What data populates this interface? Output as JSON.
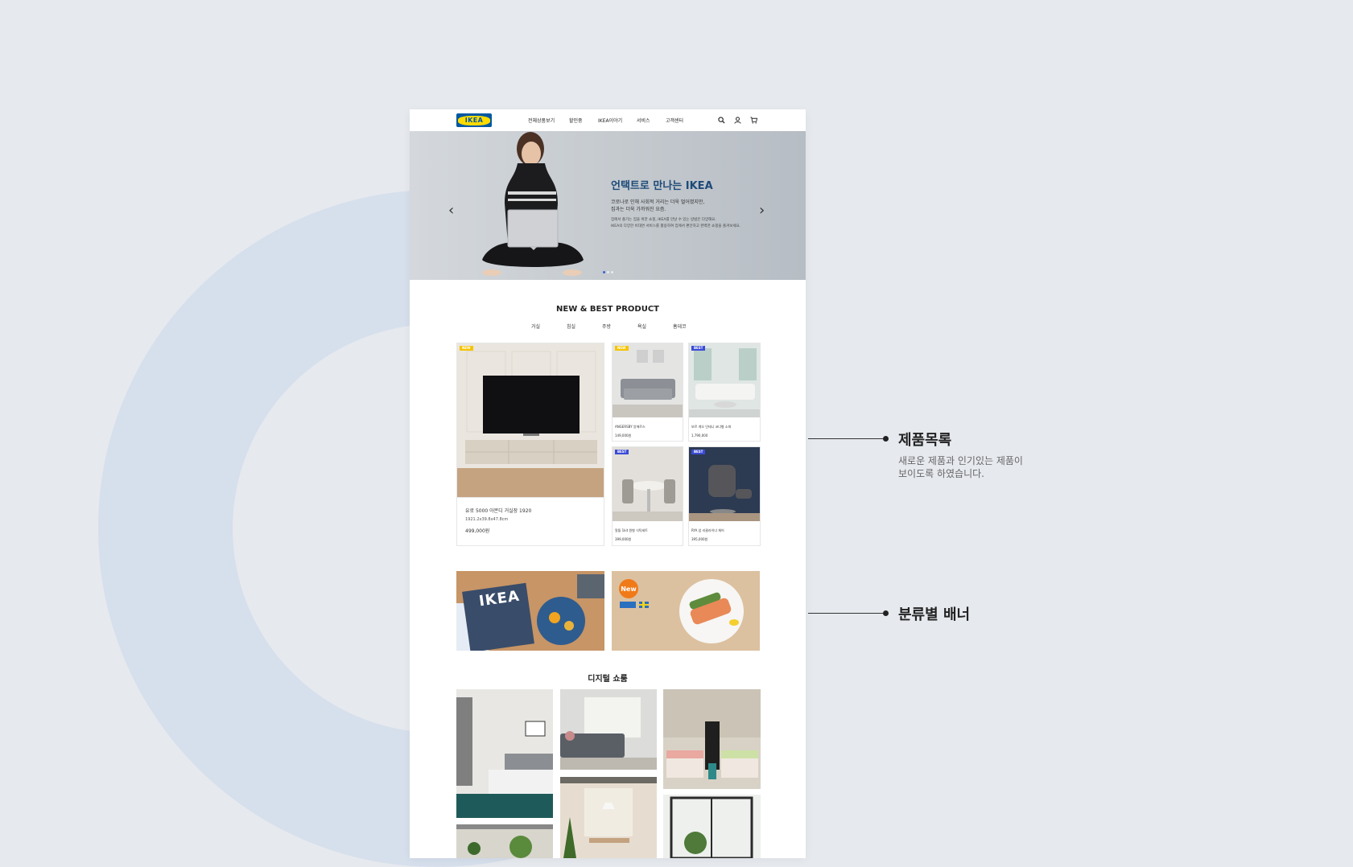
{
  "header": {
    "logo": "IKEA",
    "nav": [
      "전체상품보기",
      "할인중",
      "IKEA이야기",
      "서비스",
      "고객센터"
    ]
  },
  "hero": {
    "title": "언택트로 만나는 IKEA",
    "subtitle": [
      "코로나로 인해 사회적 거리는 더욱 멀어졌지만,",
      "집과는 더욱 가까워진 요즘."
    ],
    "small": [
      "집에서 즐기는 집을 위한 쇼핑, IKEA를 만날 수 있는 방법은 다양해요.",
      "IKEA의 다양한 비대면 서비스를 활용하여 집에서 편안하고 완벽한 쇼핑을 즐겨보세요."
    ],
    "slides": 3,
    "active_slide": 1
  },
  "products": {
    "title": "NEW & BEST PRODUCT",
    "categories": [
      "거실",
      "침실",
      "주방",
      "욕실",
      "홈데코"
    ],
    "featured": {
      "badge": "NEW",
      "name": "유로 5000 아몬디 거실장 1920",
      "size": "1921.2x39.8x47.8cm",
      "price": "499,000원"
    },
    "items": [
      {
        "badge": "NEW",
        "name": "ANGERSBY 앙에르스",
        "price": "149,000원"
      },
      {
        "badge": "BEST",
        "name": "보르 게오 인테니 코너형 소파",
        "price": "1,790,000"
      },
      {
        "badge": "BEST",
        "name": "알뜰 1kit 원형 식탁세트",
        "price": "399,000원"
      },
      {
        "badge": "BEST",
        "name": "RYA 암 리클라이너 체어",
        "price": "395,000원"
      }
    ]
  },
  "banners": {
    "left_logo": "IKEA",
    "right_badge": "New"
  },
  "digital": {
    "title": "디지털 쇼룸"
  },
  "annotations": [
    {
      "title": "제품목록",
      "desc": [
        "새로운 제품과 인기있는 제품이",
        "보이도록 하였습니다."
      ]
    },
    {
      "title": "분류별 배너",
      "desc": []
    }
  ],
  "colors": {
    "background": "#e6e9ee",
    "ring": "#d6dfec",
    "ikea_blue": "#0058a3",
    "ikea_yellow": "#ffdb00",
    "badge_new": "#f5c400",
    "badge_best": "#3b4bd6",
    "hero_title": "#1e4a78"
  }
}
